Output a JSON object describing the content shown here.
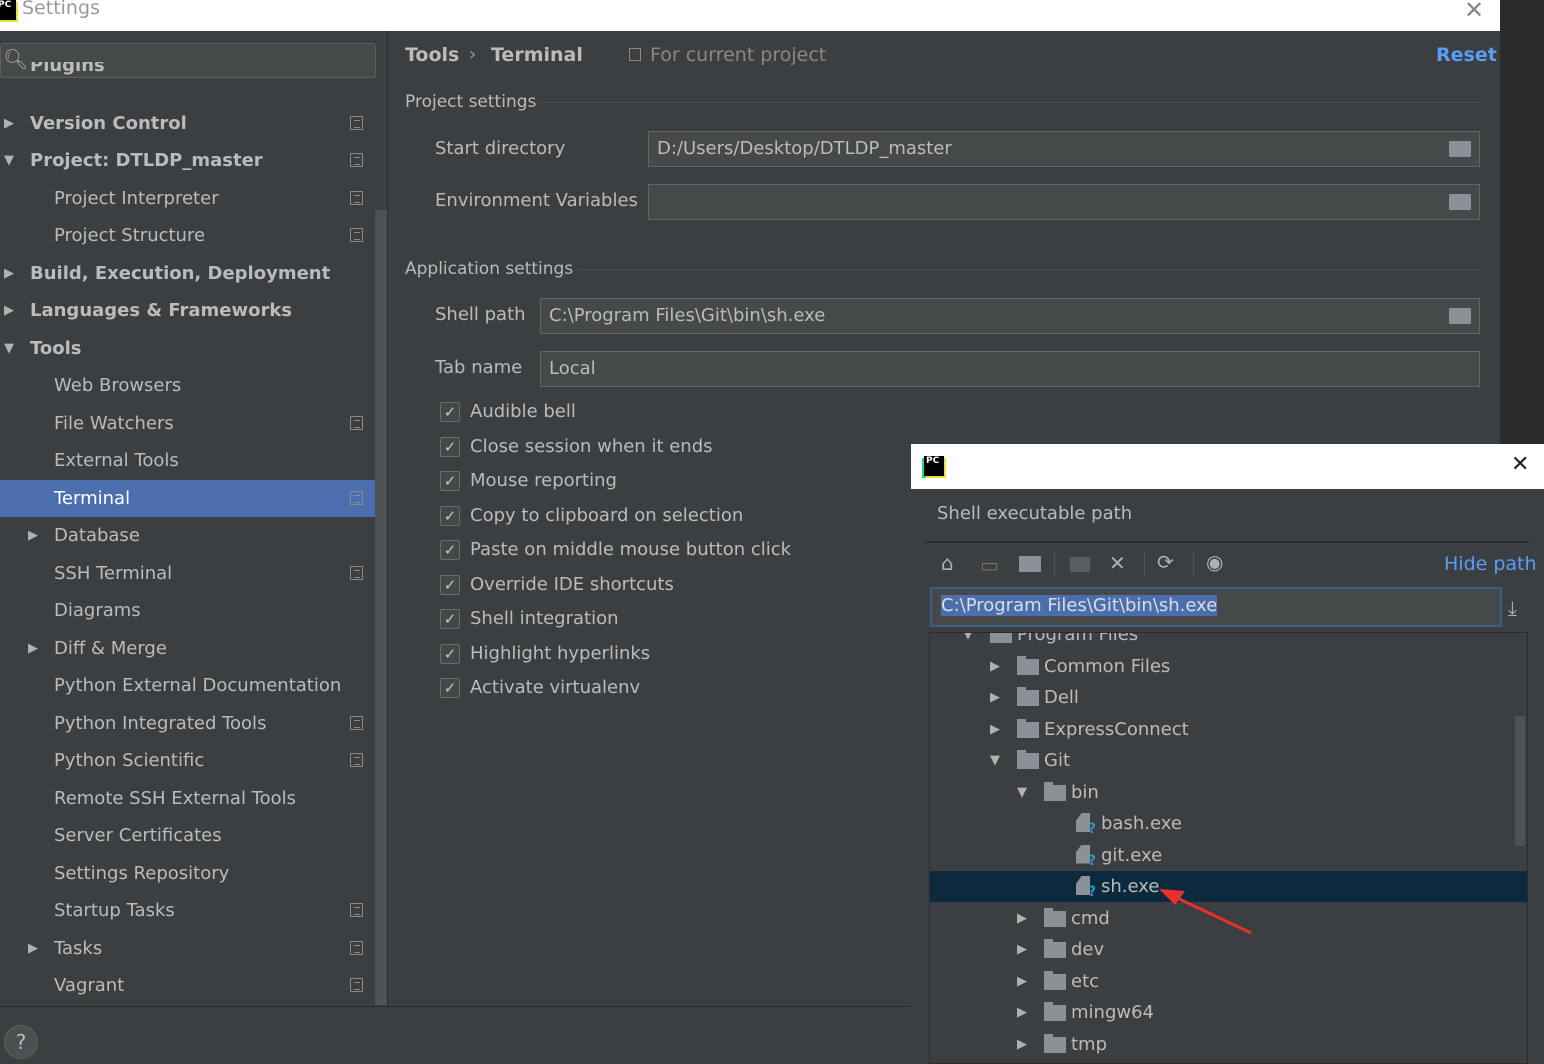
{
  "window": {
    "title": "Settings",
    "logo": "PC"
  },
  "sidebar": {
    "search_placeholder": "",
    "items": [
      {
        "label": "Plugins",
        "level": 0,
        "bold": true,
        "arrow": "",
        "copy": false,
        "partial": true
      },
      {
        "label": "Version Control",
        "level": 0,
        "bold": true,
        "arrow": "right",
        "copy": true
      },
      {
        "label": "Project: DTLDP_master",
        "level": 0,
        "bold": true,
        "arrow": "down",
        "copy": true
      },
      {
        "label": "Project Interpreter",
        "level": 1,
        "arrow": "",
        "copy": true
      },
      {
        "label": "Project Structure",
        "level": 1,
        "arrow": "",
        "copy": true
      },
      {
        "label": "Build, Execution, Deployment",
        "level": 0,
        "bold": true,
        "arrow": "right",
        "copy": false
      },
      {
        "label": "Languages & Frameworks",
        "level": 0,
        "bold": true,
        "arrow": "right",
        "copy": false
      },
      {
        "label": "Tools",
        "level": 0,
        "bold": true,
        "arrow": "down",
        "copy": false
      },
      {
        "label": "Web Browsers",
        "level": 1,
        "arrow": "",
        "copy": false
      },
      {
        "label": "File Watchers",
        "level": 1,
        "arrow": "",
        "copy": true
      },
      {
        "label": "External Tools",
        "level": 1,
        "arrow": "",
        "copy": false
      },
      {
        "label": "Terminal",
        "level": 1,
        "arrow": "",
        "copy": true,
        "selected": true
      },
      {
        "label": "Database",
        "level": 1,
        "arrow": "right",
        "copy": false
      },
      {
        "label": "SSH Terminal",
        "level": 1,
        "arrow": "",
        "copy": true
      },
      {
        "label": "Diagrams",
        "level": 1,
        "arrow": "",
        "copy": false
      },
      {
        "label": "Diff & Merge",
        "level": 1,
        "arrow": "right",
        "copy": false
      },
      {
        "label": "Python External Documentation",
        "level": 1,
        "arrow": "",
        "copy": false
      },
      {
        "label": "Python Integrated Tools",
        "level": 1,
        "arrow": "",
        "copy": true
      },
      {
        "label": "Python Scientific",
        "level": 1,
        "arrow": "",
        "copy": true
      },
      {
        "label": "Remote SSH External Tools",
        "level": 1,
        "arrow": "",
        "copy": false
      },
      {
        "label": "Server Certificates",
        "level": 1,
        "arrow": "",
        "copy": false
      },
      {
        "label": "Settings Repository",
        "level": 1,
        "arrow": "",
        "copy": false
      },
      {
        "label": "Startup Tasks",
        "level": 1,
        "arrow": "",
        "copy": true
      },
      {
        "label": "Tasks",
        "level": 1,
        "arrow": "right",
        "copy": true
      },
      {
        "label": "Vagrant",
        "level": 1,
        "arrow": "",
        "copy": true
      }
    ]
  },
  "header": {
    "breadcrumb": [
      "Tools",
      "Terminal"
    ],
    "scope": "For current project",
    "reset": "Reset"
  },
  "project_settings": {
    "title": "Project settings",
    "start_directory_label": "Start directory",
    "start_directory": "D:/Users/Desktop/DTLDP_master",
    "env_label": "Environment Variables",
    "env": ""
  },
  "app_settings": {
    "title": "Application settings",
    "shell_path_label": "Shell path",
    "shell_path": "C:\\Program Files\\Git\\bin\\sh.exe",
    "tab_name_label": "Tab name",
    "tab_name": "Local",
    "checkboxes": [
      {
        "label": "Audible bell",
        "checked": true
      },
      {
        "label": "Close session when it ends",
        "checked": true
      },
      {
        "label": "Mouse reporting",
        "checked": true
      },
      {
        "label": "Copy to clipboard on selection",
        "checked": true
      },
      {
        "label": "Paste on middle mouse button click",
        "checked": true
      },
      {
        "label": "Override IDE shortcuts",
        "checked": true
      },
      {
        "label": "Shell integration",
        "checked": true
      },
      {
        "label": "Highlight hyperlinks",
        "checked": true
      },
      {
        "label": "Activate virtualenv",
        "checked": true
      }
    ]
  },
  "popup": {
    "logo": "PC",
    "title": "Shell executable path",
    "hide_path": "Hide path",
    "path": "C:\\Program Files\\Git\\bin\\sh.exe",
    "toolbar": [
      "home-icon",
      "desktop-icon",
      "project-folder-icon",
      "new-folder-icon",
      "delete-icon",
      "refresh-icon",
      "show-hidden-icon"
    ],
    "tree": [
      {
        "label": "Program Files",
        "level": 0,
        "type": "folder",
        "expanded": true
      },
      {
        "label": "Common Files",
        "level": 1,
        "type": "folder",
        "expanded": false
      },
      {
        "label": "Dell",
        "level": 1,
        "type": "folder",
        "expanded": false
      },
      {
        "label": "ExpressConnect",
        "level": 1,
        "type": "folder",
        "expanded": false
      },
      {
        "label": "Git",
        "level": 1,
        "type": "folder",
        "expanded": true
      },
      {
        "label": "bin",
        "level": 2,
        "type": "folder",
        "expanded": true
      },
      {
        "label": "bash.exe",
        "level": 3,
        "type": "file"
      },
      {
        "label": "git.exe",
        "level": 3,
        "type": "file"
      },
      {
        "label": "sh.exe",
        "level": 3,
        "type": "file",
        "selected": true
      },
      {
        "label": "cmd",
        "level": 2,
        "type": "folder",
        "expanded": false
      },
      {
        "label": "dev",
        "level": 2,
        "type": "folder",
        "expanded": false
      },
      {
        "label": "etc",
        "level": 2,
        "type": "folder",
        "expanded": false
      },
      {
        "label": "mingw64",
        "level": 2,
        "type": "folder",
        "expanded": false
      },
      {
        "label": "tmp",
        "level": 2,
        "type": "folder",
        "expanded": false
      }
    ]
  },
  "colors": {
    "accent": "#4b6eaf",
    "link": "#589df6",
    "annotation_arrow": "#e8302a"
  }
}
